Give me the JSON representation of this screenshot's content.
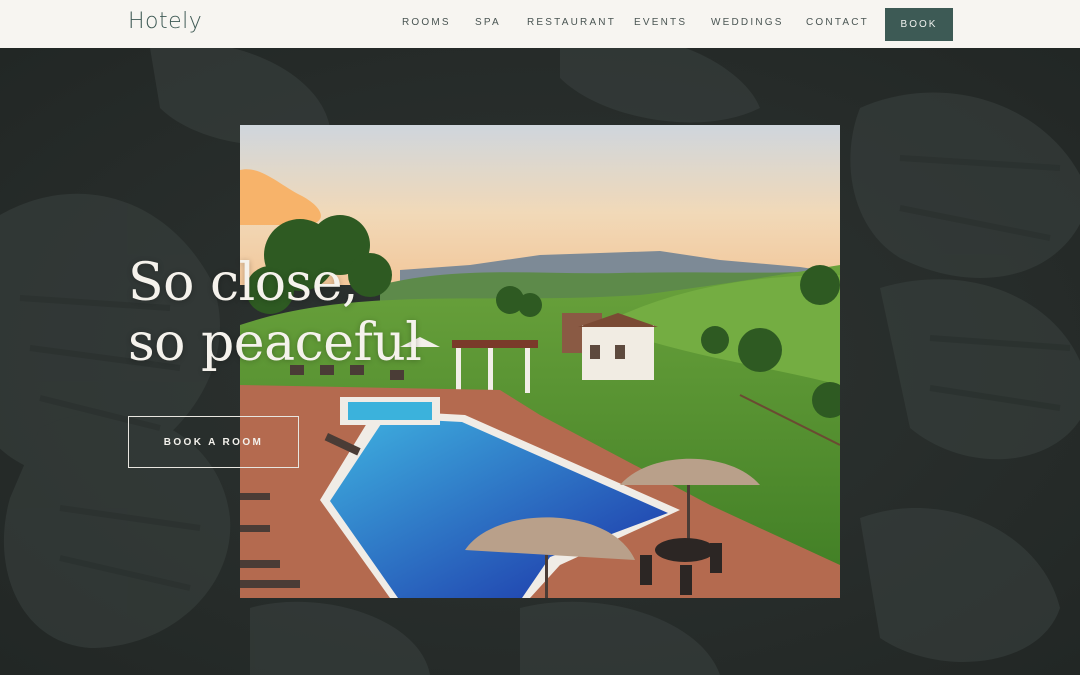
{
  "header": {
    "logo": "Hotely",
    "nav": [
      "ROOMS",
      "SPA",
      "RESTAURANT",
      "EVENTS",
      "WEDDINGS",
      "CONTACT"
    ],
    "book_label": "BOOK"
  },
  "hero": {
    "headline_line1": "So close,",
    "headline_line2": "so peaceful",
    "cta_label": "BOOK A ROOM"
  },
  "colors": {
    "header_bg": "#f7f5f1",
    "accent": "#3d5a55",
    "hero_bg": "#2b302e"
  }
}
